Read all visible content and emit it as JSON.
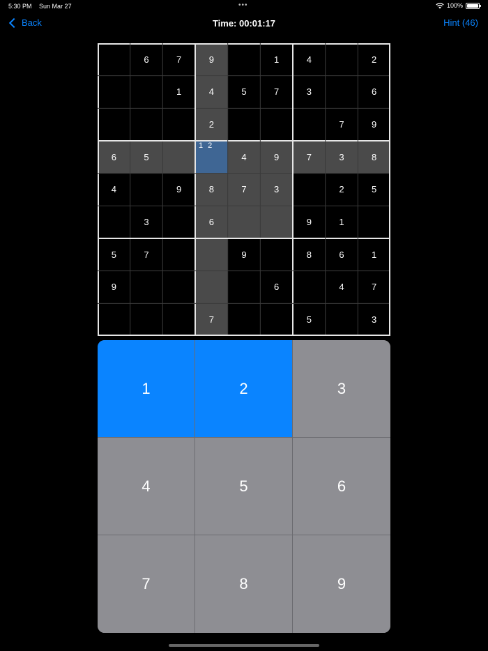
{
  "status": {
    "time": "5:30 PM",
    "date": "Sun Mar 27",
    "battery": "100%",
    "dots": "•••"
  },
  "nav": {
    "back": "Back",
    "title": "Time: 00:01:17",
    "hint": "Hint (46)"
  },
  "board": {
    "grid": [
      [
        "",
        "6",
        "7",
        "9",
        "",
        "1",
        "4",
        "",
        "2"
      ],
      [
        "",
        "",
        "1",
        "4",
        "5",
        "7",
        "3",
        "",
        "6"
      ],
      [
        "",
        "",
        "",
        "2",
        "",
        "",
        "",
        "7",
        "9"
      ],
      [
        "6",
        "5",
        "",
        "",
        "4",
        "9",
        "7",
        "3",
        "8"
      ],
      [
        "4",
        "",
        "9",
        "8",
        "7",
        "3",
        "",
        "2",
        "5"
      ],
      [
        "",
        "3",
        "",
        "6",
        "",
        "",
        "9",
        "1",
        ""
      ],
      [
        "5",
        "7",
        "",
        "",
        "9",
        "",
        "8",
        "6",
        "1"
      ],
      [
        "9",
        "",
        "",
        "",
        "",
        "6",
        "",
        "4",
        "7"
      ],
      [
        "",
        "",
        "",
        "7",
        "",
        "",
        "5",
        "",
        "3"
      ]
    ],
    "selected": {
      "row": 3,
      "col": 3
    },
    "selected_notes": "1 2"
  },
  "keypad": {
    "keys": [
      "1",
      "2",
      "3",
      "4",
      "5",
      "6",
      "7",
      "8",
      "9"
    ],
    "active": [
      "1",
      "2"
    ]
  },
  "colors": {
    "accent": "#0a84ff",
    "highlight": "#4a4a4a",
    "selected": "#3f6694",
    "key": "#8e8e93"
  }
}
